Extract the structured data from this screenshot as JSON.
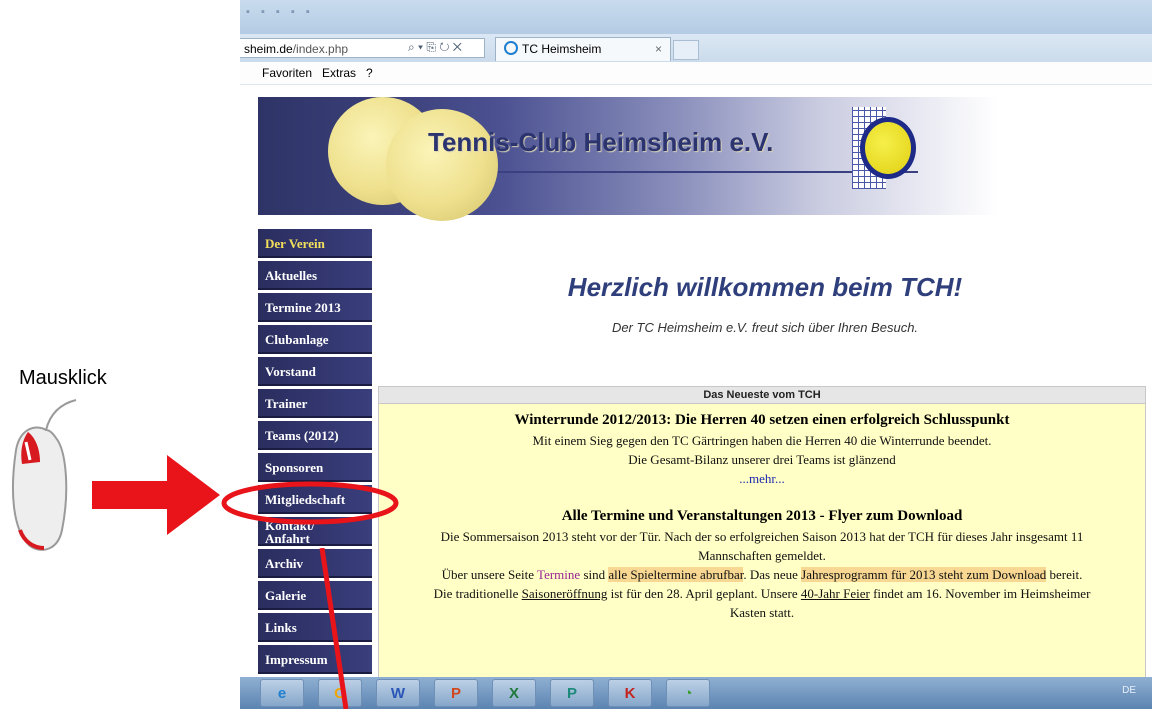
{
  "browser": {
    "url_host": "sheim.de",
    "url_path": "/index.php",
    "url_tools": "⌕ ▾ ⎘ ↻ ✕",
    "tab_title": "TC Heimsheim",
    "tab_close": "×",
    "menu": [
      "Favoriten",
      "Extras",
      "?"
    ]
  },
  "banner": {
    "title": "Tennis-Club Heimsheim e.V."
  },
  "nav": {
    "items": [
      {
        "label": "Der Verein",
        "active": true
      },
      {
        "label": "Aktuelles"
      },
      {
        "label": "Termine 2013"
      },
      {
        "label": "Clubanlage"
      },
      {
        "label": "Vorstand"
      },
      {
        "label": "Trainer"
      },
      {
        "label": "Teams (2012)"
      },
      {
        "label": "Sponsoren"
      },
      {
        "label": "Mitgliedschaft"
      },
      {
        "label_line1": "Kontakt/",
        "label_line2": "Anfahrt"
      },
      {
        "label": "Archiv"
      },
      {
        "label": "Galerie"
      },
      {
        "label": "Links"
      },
      {
        "label": "Impressum"
      }
    ]
  },
  "main": {
    "welcome": "Herzlich willkommen beim TCH!",
    "welcome_sub": "Der TC Heimsheim e.V. freut sich über Ihren Besuch."
  },
  "news": {
    "header": "Das Neueste vom TCH",
    "item1": {
      "title": "Winterrunde 2012/2013: Die Herren 40 setzen einen erfolgreich Schlusspunkt",
      "line1": "Mit einem Sieg gegen den TC Gärtringen haben die Herren 40 die Winterrunde beendet.",
      "line2": "Die Gesamt-Bilanz unserer drei Teams ist glänzend",
      "more": "...mehr..."
    },
    "item2": {
      "title": "Alle Termine und Veranstaltungen 2013 - Flyer zum Download",
      "p1a": "Die Sommersaison 2013 steht vor der Tür. Nach der so erfolgreichen Saison 2013 hat der TCH für dieses Jahr insgesamt 11",
      "p1b": "Mannschaften gemeldet.",
      "p2_pre": "Über unsere Seite ",
      "p2_link": "Termine",
      "p2_mid": " sind ",
      "p2_hl1": "alle Spieltermine abrufbar",
      "p2_mid2": ". Das neue ",
      "p2_hl2": "Jahresprogramm für 2013 steht zum Download",
      "p2_end": " bereit.",
      "p3_pre": "Die traditionelle ",
      "p3_link1": "Saisoneröffnung",
      "p3_mid": " ist für den 28. April geplant. Unsere ",
      "p3_link2": "40-Jahr Feier",
      "p3_end": " findet am 16. November im Heimsheimer",
      "p3b": "Kasten statt."
    }
  },
  "taskbar": {
    "apps": [
      {
        "icon": "internet-explorer-icon",
        "glyph": "e"
      },
      {
        "icon": "outlook-icon",
        "glyph": "O"
      },
      {
        "icon": "word-icon",
        "glyph": "W"
      },
      {
        "icon": "powerpoint-icon",
        "glyph": "P"
      },
      {
        "icon": "excel-icon",
        "glyph": "X"
      },
      {
        "icon": "publisher-icon",
        "glyph": "P"
      },
      {
        "icon": "app-k-icon",
        "glyph": "K"
      },
      {
        "icon": "picasa-icon",
        "glyph": "◔"
      }
    ],
    "tray_lang": "DE"
  },
  "annotation": {
    "label": "Mausklick",
    "color": "#e8141a"
  }
}
